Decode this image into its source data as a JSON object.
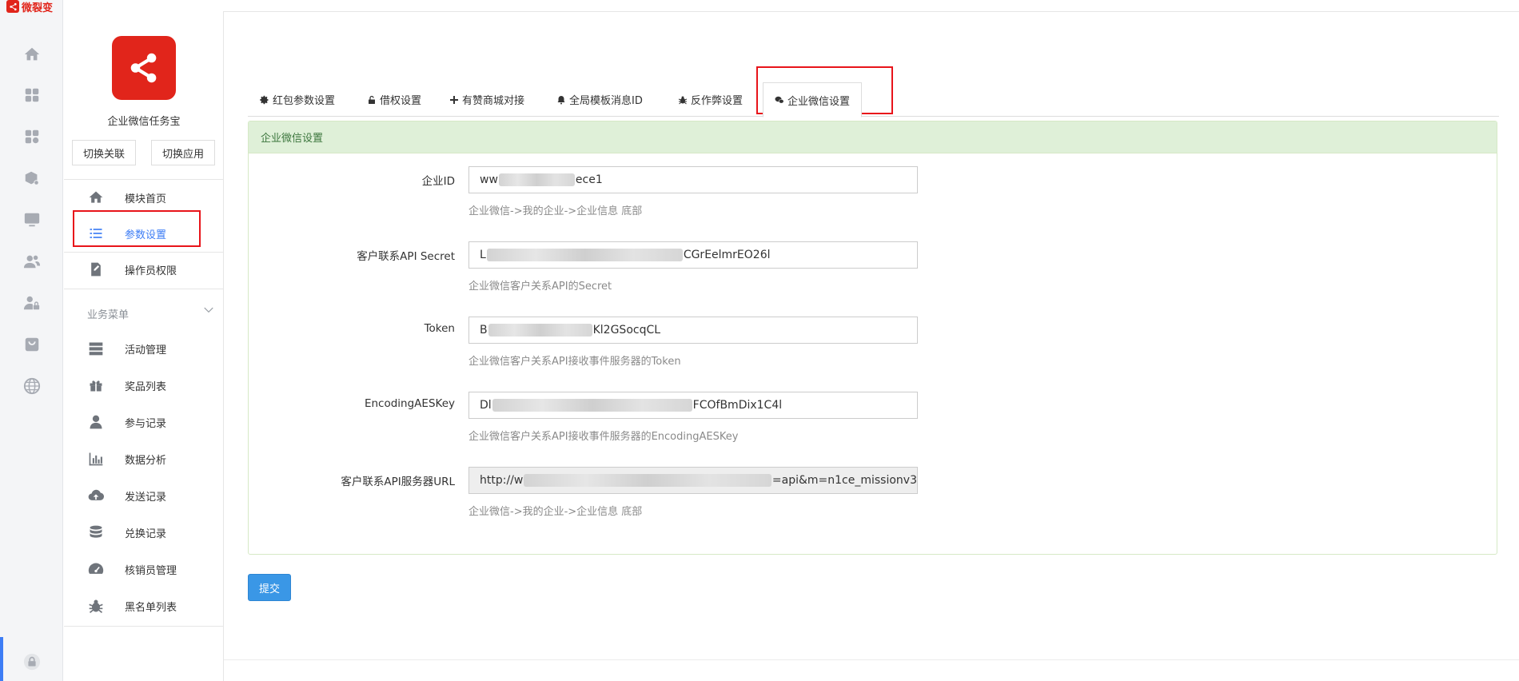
{
  "brand": {
    "name": "微裂变",
    "color": "#e1251b"
  },
  "rail": {
    "icons": [
      "home-icon",
      "apps-grid-icon",
      "apps-settings-icon",
      "box-settings-icon",
      "monitor-icon",
      "users-icon",
      "user-lock-icon",
      "bag-icon",
      "globe-icon",
      "lock-icon"
    ],
    "accent": "#3d7df5"
  },
  "sidebar": {
    "app_name": "企业微信任务宝",
    "switch_link_label": "切换关联",
    "switch_app_label": "切换应用",
    "top_items": [
      {
        "label": "模块首页",
        "icon": "home-icon"
      },
      {
        "label": "参数设置",
        "icon": "list-icon",
        "active": true
      },
      {
        "label": "操作员权限",
        "icon": "edit-doc-icon"
      }
    ],
    "group_label": "业务菜单",
    "business_items": [
      {
        "label": "活动管理",
        "icon": "server-icon"
      },
      {
        "label": "奖品列表",
        "icon": "gift-icon"
      },
      {
        "label": "参与记录",
        "icon": "user-icon"
      },
      {
        "label": "数据分析",
        "icon": "bar-chart-icon"
      },
      {
        "label": "发送记录",
        "icon": "cloud-upload-icon"
      },
      {
        "label": "兑换记录",
        "icon": "database-icon"
      },
      {
        "label": "核销员管理",
        "icon": "dashboard-icon"
      },
      {
        "label": "黑名单列表",
        "icon": "bug-icon"
      }
    ]
  },
  "tabs": [
    {
      "label": "红包参数设置",
      "icon": "gear-icon"
    },
    {
      "label": "借权设置",
      "icon": "unlock-icon"
    },
    {
      "label": "有赞商城对接",
      "icon": "plus-icon"
    },
    {
      "label": "全局模板消息ID",
      "icon": "bell-icon"
    },
    {
      "label": "反作弊设置",
      "icon": "bug-icon"
    },
    {
      "label": "企业微信设置",
      "icon": "wechat-icon",
      "active": true
    }
  ],
  "panel": {
    "title": "企业微信设置",
    "fields": [
      {
        "label": "企业ID",
        "value_prefix": "ww",
        "value_suffix": "ece1",
        "help": "企业微信->我的企业->企业信息 底部"
      },
      {
        "label": "客户联系API Secret",
        "value_prefix": "L",
        "value_suffix": "CGrEelmrEO26l",
        "help": "企业微信客户关系API的Secret"
      },
      {
        "label": "Token",
        "value_prefix": "B",
        "value_suffix": "Kl2GSocqCL",
        "help": "企业微信客户关系API接收事件服务器的Token"
      },
      {
        "label": "EncodingAESKey",
        "value_prefix": "Dl",
        "value_suffix": "FCOfBmDix1C4l",
        "help": "企业微信客户关系API接收事件服务器的EncodingAESKey"
      },
      {
        "label": "客户联系API服务器URL",
        "value_prefix": "http://w",
        "value_suffix": "=api&m=n1ce_missionv3",
        "help": "企业微信->我的企业->企业信息 底部",
        "readonly": true
      }
    ]
  },
  "submit_label": "提交"
}
